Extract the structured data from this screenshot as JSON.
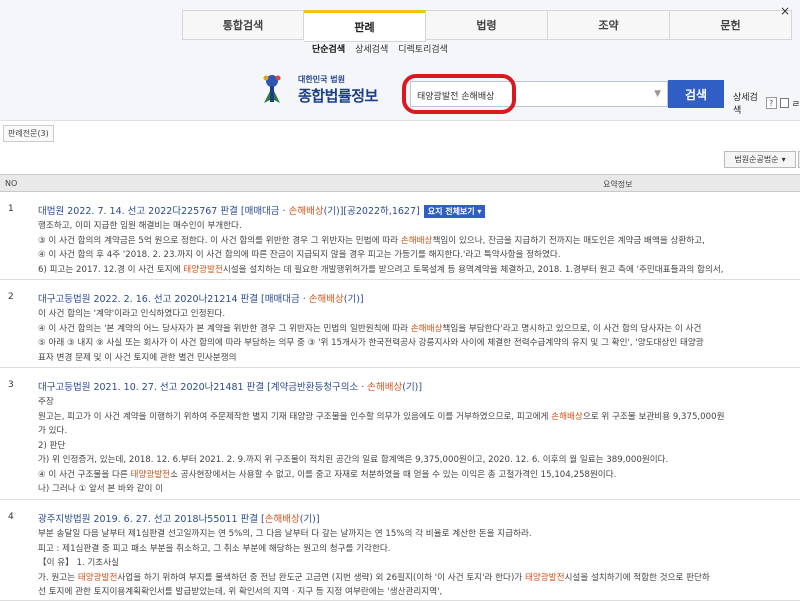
{
  "nav": {
    "tabs": [
      "통합검색",
      "판례",
      "법령",
      "조약",
      "문헌"
    ],
    "active_tab": 1,
    "close_glyph": "×"
  },
  "subnav": [
    "단순검색",
    "상세검색",
    "디렉토리검색"
  ],
  "logo": {
    "small": "대한민국 법원",
    "big": "종합법률정보"
  },
  "search": {
    "value": "태양광발전 손해배상",
    "button": "검색",
    "advanced": "상세검색",
    "help": "?",
    "checkbox_label": "ㄹ"
  },
  "toolbar": {
    "tab_chip": "판례전문(3)",
    "sort": "법원순공법순"
  },
  "table_header": {
    "no": "NO",
    "summary": "요약정보"
  },
  "results": [
    {
      "no": "1",
      "title_pre": "대법원 2022. 7. 14. 선고 2022다225767 판결 [매매대금 · ",
      "title_hl": "손해배상",
      "title_post": "(기)][공2022하,1627]",
      "badge": "요지 전체보기 ▾",
      "lines": [
        "행조하고, 이미 지급한 임원 해결비는 매수인이 부개한다.",
        "③ 이 사건 합의의 계약금은 5억 원으로 정한다. 이 사건 합의를 위반한 경우 그 위반자는 민법에 따라 손해배상책임이 있으나, 잔금을 지급하기 전까지는 매도인은 계약금 배액을 상환하고,",
        "④ 이 사건 합의 후 4주 '2018. 2. 23.까지 이 사건 합의에 따른 잔금이 지급되지 않을 경우 피고는 가등기를 해지한다.'라고 특약사항을 정하였다.",
        "6) 피고는 2017. 12.경 이 사건 토지에 태양광발전시설을 설치하는 데 필요한 개발행위허가를 받으려고 토목설계 등 용역계약을 체결하고, 2018. 1.경부터 원고 측에 '주민대표들과의 합의서,"
      ]
    },
    {
      "no": "2",
      "title_pre": "대구고등법원 2022. 2. 16. 선고 2020나21214 판결 [매매대금 · ",
      "title_hl": "손해배상",
      "title_post": "(기)]",
      "badge": "",
      "lines": [
        "이 사건 합의는 '계약'이라고 인식하였다고 인정된다.",
        "④ 이 사건 합의는 '본 계약의 어느 당사자가 본 계약을 위반한 경우 그 위반자는 민법의 일반원칙에 따라 손해배상책임을 부담한다'라고 명시하고 있으므로, 이 사건 합의 당사자는 이 사건",
        "⑤ 아래 ③ 내지 ⑨ 사실 또는 회사가 이 사건 합의에 따라 부담하는 의무 중 ③ '위 15개사가 한국전력공사 강릉지사와 사이에 체결한 전력수급계약의 유지 및 그 확인', '양도대상인 태양광",
        "표자 변경 문제 및 이 사건 토지에 관한 별건 민사분쟁의"
      ]
    },
    {
      "no": "3",
      "title_pre": "대구고등법원 2021. 10. 27. 선고 2020나21481 판결 [계약금반환등청구의소 · ",
      "title_hl": "손해배상",
      "title_post": "(기)]",
      "badge": "",
      "lines": [
        "주장",
        "원고는, 피고가 이 사건 계약을 이행하기 위하여 주문제작한 별지 기재 태양광 구조물을 인수할 의무가 있음에도 이를 거부하였으므로, 피고에게 손해배상으로 위 구조물 보관비용 9,375,000원",
        "가 있다.",
        "2) 판단",
        "가) 위 인정증거, 있는데, 2018. 12. 6.부터 2021. 2. 9.까지 위 구조물이 적치된 공간의 일료 합계액은 9,375,000원이고, 2020. 12. 6. 이후의 월 일료는 389,000원이다.",
        "④ 이 사건 구조물을 다른 태양광발전소 공사현장에서는 사용할 수 없고, 이를 중고 자재로 처분하였을 때 얻을 수 있는 이익은 총 고철가격인 15,104,258원이다.",
        "나) 그러나 ① 앞서 본 바와 같이 이"
      ]
    },
    {
      "no": "4",
      "title_pre": "광주지방법원 2019. 6. 27. 선고 2018나55011 판결 [",
      "title_hl": "손해배상",
      "title_post": "(기)]",
      "badge": "",
      "lines": [
        "부분 송달일 다음 날부터 제1심판결 선고일까지는 연 5%의, 그 다음 날부터 다 갚는 날까지는 연 15%의 각 비율로 계산한 돈을 지급하라.",
        "피고 : 제1심판결 중 피고 패소 부분을 취소하고, 그 취소 부분에 해당하는 원고의 청구를 기각한다.",
        "【이 유】 1. 기초사실",
        "가. 원고는 태양광발전사업을 하기 위하여 부지를 물색하던 중 전남 완도군 고금면 (지번 생략) 외 26필지(이하 '이 사건 토지'라 한다)가 태양광발전시설을 설치하기에 적합한 것으로 판단하",
        "선 토지에 관한 토지이용계획확인서를 발급받았는데, 위 확인서의 지역 · 지구 등 지정 여부란에는 '생산관리지역',"
      ]
    }
  ]
}
